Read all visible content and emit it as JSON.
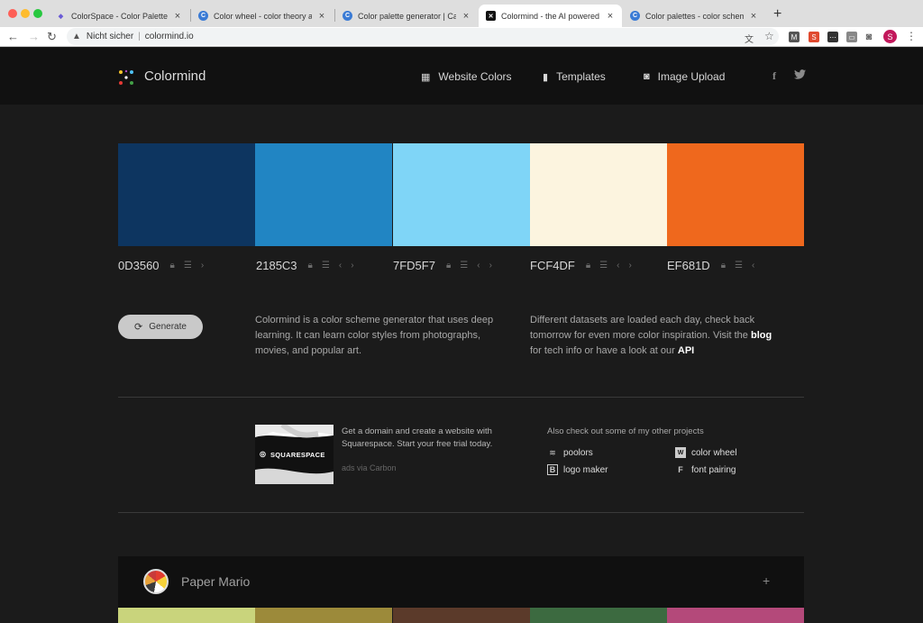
{
  "browser": {
    "tabs": [
      {
        "title": "ColorSpace - Color Palettes Ge",
        "favicon_color": "#6b5bd6"
      },
      {
        "title": "Color wheel - color theory and",
        "favicon_color": "#3a7bd5"
      },
      {
        "title": "Color palette generator | Canv",
        "favicon_color": "#3a7bd5"
      },
      {
        "title": "Colormind - the AI powered co",
        "favicon_color": "#111111"
      },
      {
        "title": "Color palettes - color scheme",
        "favicon_color": "#3a7bd5"
      }
    ],
    "address": {
      "security": "Nicht sicher",
      "url": "colormind.io"
    },
    "profile_initial": "S"
  },
  "header": {
    "logo_text": "Colormind",
    "nav": [
      {
        "label": "Website Colors",
        "icon": "grid-icon"
      },
      {
        "label": "Templates",
        "icon": "bookmark-icon"
      },
      {
        "label": "Image Upload",
        "icon": "camera-icon"
      }
    ],
    "social": [
      "f",
      "t"
    ]
  },
  "palette": {
    "colors": [
      {
        "hex": "0D3560",
        "color": "#0D3560"
      },
      {
        "hex": "2185C3",
        "color": "#2185C3"
      },
      {
        "hex": "7FD5F7",
        "color": "#7FD5F7"
      },
      {
        "hex": "FCF4DF",
        "color": "#FCF4DF"
      },
      {
        "hex": "EF681D",
        "color": "#EF681D"
      }
    ]
  },
  "generate": {
    "label": "Generate"
  },
  "about": {
    "left": "Colormind is a color scheme generator that uses deep learning. It can learn color styles from photographs, movies, and popular art.",
    "right_pre": "Different datasets are loaded each day, check back tomorrow for even more color inspiration. Visit the",
    "right_blog": "blog",
    "right_mid": "for tech info or have a look at our",
    "right_api": "API"
  },
  "ad": {
    "brand": "SQUARESPACE",
    "text": "Get a domain and create a website with Squarespace. Start your free trial today.",
    "via": "ads via Carbon"
  },
  "projects": {
    "title": "Also check out some of my other projects",
    "items": [
      "poolors",
      "color wheel",
      "logo maker",
      "font pairing"
    ]
  },
  "card": {
    "title": "Paper Mario",
    "plus": "+",
    "strip_colors": [
      "#C9D47C",
      "#9C8A3A",
      "#5B3A2A",
      "#3C6A40",
      "#B4497A"
    ]
  }
}
